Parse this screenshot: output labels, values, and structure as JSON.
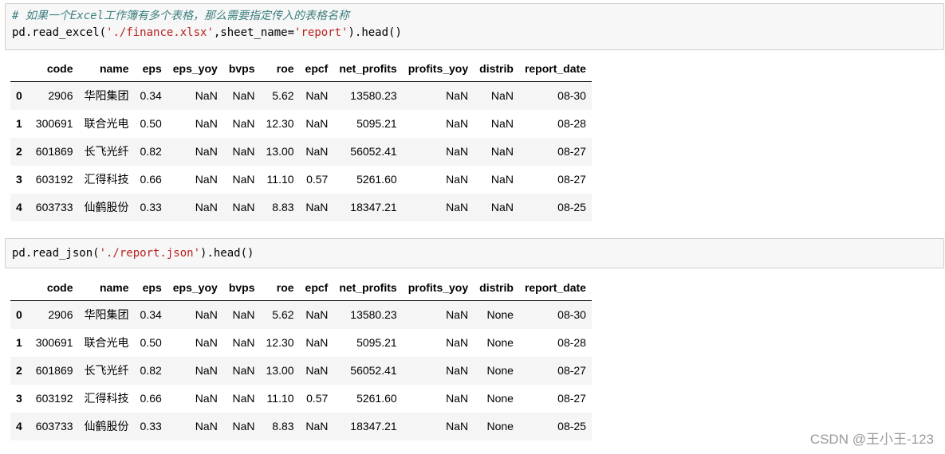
{
  "cell1": {
    "comment": "# 如果一个Excel工作簿有多个表格，那么需要指定传入的表格名称",
    "code_pre": "pd.read_excel(",
    "code_path": "'./finance.xlsx'",
    "code_mid": ",sheet_name=",
    "code_sheet": "'report'",
    "code_post": ").head()"
  },
  "cell2": {
    "code_pre": "pd.read_json(",
    "code_path": "'./report.json'",
    "code_post": ").head()"
  },
  "columns": [
    "code",
    "name",
    "eps",
    "eps_yoy",
    "bvps",
    "roe",
    "epcf",
    "net_profits",
    "profits_yoy",
    "distrib",
    "report_date"
  ],
  "table1": {
    "rows": [
      {
        "index": "0",
        "code": "2906",
        "name": "华阳集团",
        "eps": "0.34",
        "eps_yoy": "NaN",
        "bvps": "NaN",
        "roe": "5.62",
        "epcf": "NaN",
        "net_profits": "13580.23",
        "profits_yoy": "NaN",
        "distrib": "NaN",
        "report_date": "08-30"
      },
      {
        "index": "1",
        "code": "300691",
        "name": "联合光电",
        "eps": "0.50",
        "eps_yoy": "NaN",
        "bvps": "NaN",
        "roe": "12.30",
        "epcf": "NaN",
        "net_profits": "5095.21",
        "profits_yoy": "NaN",
        "distrib": "NaN",
        "report_date": "08-28"
      },
      {
        "index": "2",
        "code": "601869",
        "name": "长飞光纤",
        "eps": "0.82",
        "eps_yoy": "NaN",
        "bvps": "NaN",
        "roe": "13.00",
        "epcf": "NaN",
        "net_profits": "56052.41",
        "profits_yoy": "NaN",
        "distrib": "NaN",
        "report_date": "08-27"
      },
      {
        "index": "3",
        "code": "603192",
        "name": "汇得科技",
        "eps": "0.66",
        "eps_yoy": "NaN",
        "bvps": "NaN",
        "roe": "11.10",
        "epcf": "0.57",
        "net_profits": "5261.60",
        "profits_yoy": "NaN",
        "distrib": "NaN",
        "report_date": "08-27"
      },
      {
        "index": "4",
        "code": "603733",
        "name": "仙鹤股份",
        "eps": "0.33",
        "eps_yoy": "NaN",
        "bvps": "NaN",
        "roe": "8.83",
        "epcf": "NaN",
        "net_profits": "18347.21",
        "profits_yoy": "NaN",
        "distrib": "NaN",
        "report_date": "08-25"
      }
    ]
  },
  "table2": {
    "rows": [
      {
        "index": "0",
        "code": "2906",
        "name": "华阳集团",
        "eps": "0.34",
        "eps_yoy": "NaN",
        "bvps": "NaN",
        "roe": "5.62",
        "epcf": "NaN",
        "net_profits": "13580.23",
        "profits_yoy": "NaN",
        "distrib": "None",
        "report_date": "08-30"
      },
      {
        "index": "1",
        "code": "300691",
        "name": "联合光电",
        "eps": "0.50",
        "eps_yoy": "NaN",
        "bvps": "NaN",
        "roe": "12.30",
        "epcf": "NaN",
        "net_profits": "5095.21",
        "profits_yoy": "NaN",
        "distrib": "None",
        "report_date": "08-28"
      },
      {
        "index": "2",
        "code": "601869",
        "name": "长飞光纤",
        "eps": "0.82",
        "eps_yoy": "NaN",
        "bvps": "NaN",
        "roe": "13.00",
        "epcf": "NaN",
        "net_profits": "56052.41",
        "profits_yoy": "NaN",
        "distrib": "None",
        "report_date": "08-27"
      },
      {
        "index": "3",
        "code": "603192",
        "name": "汇得科技",
        "eps": "0.66",
        "eps_yoy": "NaN",
        "bvps": "NaN",
        "roe": "11.10",
        "epcf": "0.57",
        "net_profits": "5261.60",
        "profits_yoy": "NaN",
        "distrib": "None",
        "report_date": "08-27"
      },
      {
        "index": "4",
        "code": "603733",
        "name": "仙鹤股份",
        "eps": "0.33",
        "eps_yoy": "NaN",
        "bvps": "NaN",
        "roe": "8.83",
        "epcf": "NaN",
        "net_profits": "18347.21",
        "profits_yoy": "NaN",
        "distrib": "None",
        "report_date": "08-25"
      }
    ]
  },
  "watermark": "CSDN @王小王-123",
  "colors": {
    "comment": "#408080",
    "string": "#ba2121",
    "cell_background": "#f7f7f7",
    "row_stripe": "#f5f5f5"
  }
}
